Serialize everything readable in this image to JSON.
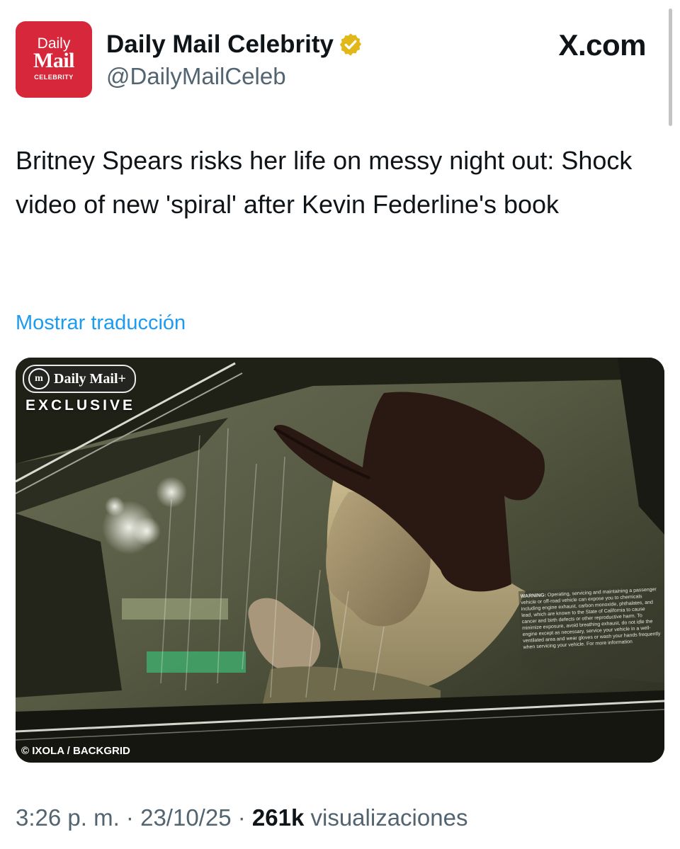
{
  "header": {
    "avatar": {
      "line1": "Daily",
      "line2": "Mail",
      "line3": "CELEBRITY",
      "color": "#d6283a"
    },
    "display_name": "Daily Mail Celebrity",
    "handle": "@DailyMailCeleb",
    "verified_badge": "gold-verified-icon",
    "source_label": "X.com"
  },
  "tweet": {
    "text": "Britney Spears risks her life on messy night out: Shock video of new 'spiral' after Kevin Federline's book",
    "translate_link": "Mostrar traducción"
  },
  "media": {
    "watermark_brand": "Daily Mail+",
    "watermark_tag": "EXCLUSIVE",
    "credit": "© IXOLA / BACKGRID",
    "sticker_heading": "WARNING:",
    "sticker_body": "Operating, servicing and maintaining a passenger vehicle or off-road vehicle can expose you to chemicals including engine exhaust, carbon monoxide, phthalates, and lead, which are known to the State of California to cause cancer and birth defects or other reproductive harm. To minimize exposure, avoid breathing exhaust, do not idle the engine except as necessary, service your vehicle in a well-ventilated area and wear gloves or wash your hands frequently when servicing your vehicle. For more information"
  },
  "meta": {
    "time": "3:26 p. m.",
    "separator": "·",
    "date": "23/10/25",
    "views_count": "261k",
    "views_label": "visualizaciones"
  }
}
